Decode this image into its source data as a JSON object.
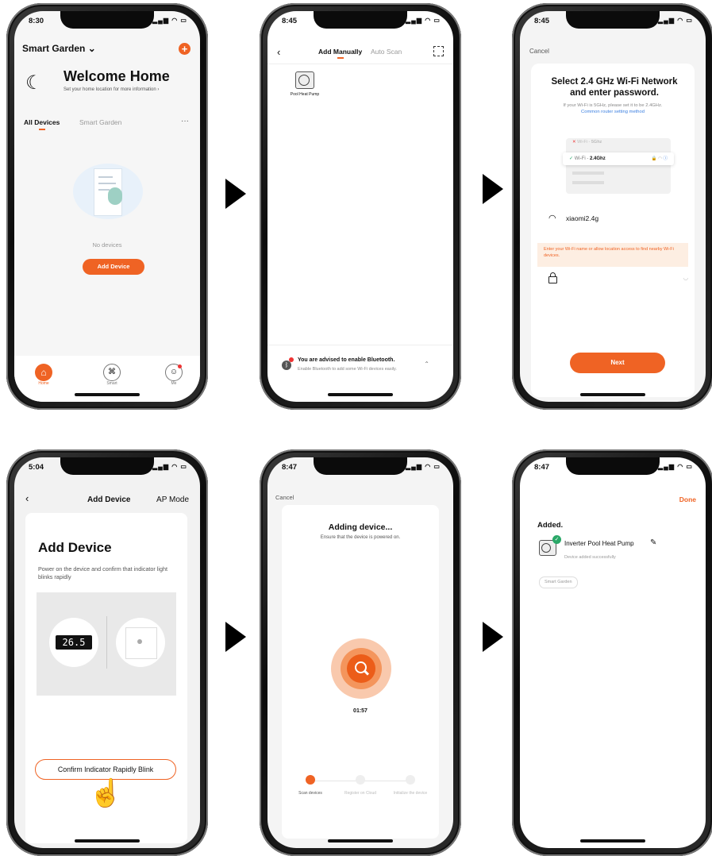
{
  "colors": {
    "accent": "#ef6324",
    "link": "#3b7fe0"
  },
  "s1": {
    "time": "8:30",
    "home_name": "Smart Garden",
    "title": "Welcome Home",
    "subtitle": "Set your home location for more information",
    "tab_all": "All Devices",
    "tab_room": "Smart Garden",
    "more": "···",
    "empty": "No devices",
    "add_btn": "Add Device",
    "nav_home": "Home",
    "nav_smart": "Smart",
    "nav_me": "Me"
  },
  "s2": {
    "time": "8:45",
    "tab_manual": "Add Manually",
    "tab_scan": "Auto Scan",
    "device": "Pool Heat Pump",
    "bt_title": "You are advised to enable Bluetooth.",
    "bt_desc": "Enable Bluetooth to add some Wi-Fi devices easily."
  },
  "s3": {
    "time": "8:45",
    "cancel": "Cancel",
    "title": "Select 2.4 GHz Wi-Fi Network and enter password.",
    "hint": "If your Wi-Fi is 5GHz, please set it to be 2.4GHz.",
    "link": "Common router setting method",
    "wifi5_prefix": "Wi-Fi - ",
    "wifi5": "5Ghz",
    "wifi24_prefix": "Wi-Fi - ",
    "wifi24": "2.4Ghz",
    "ssid": "xiaomi2.4g",
    "warning": "Enter your Wi-Fi name or allow location access to find nearby Wi-Fi devices.",
    "next": "Next"
  },
  "s4": {
    "time": "5:04",
    "title": "Add Device",
    "mode": "AP Mode",
    "heading": "Add Device",
    "desc": "Power on the device and confirm that indicator light blinks rapidly",
    "temp": "26.5",
    "confirm": "Confirm Indicator Rapidly Blink"
  },
  "s5": {
    "time": "8:47",
    "cancel": "Cancel",
    "title": "Adding device...",
    "subtitle": "Ensure that the device is powered on.",
    "timer": "01:57",
    "step1": "Scan devices",
    "step2": "Register on Cloud",
    "step3": "Initialize the device"
  },
  "s6": {
    "time": "8:47",
    "done": "Done",
    "added": "Added.",
    "device": "Inverter Pool Heat Pump",
    "status": "Device added successfully",
    "room": "Smart Garden"
  }
}
